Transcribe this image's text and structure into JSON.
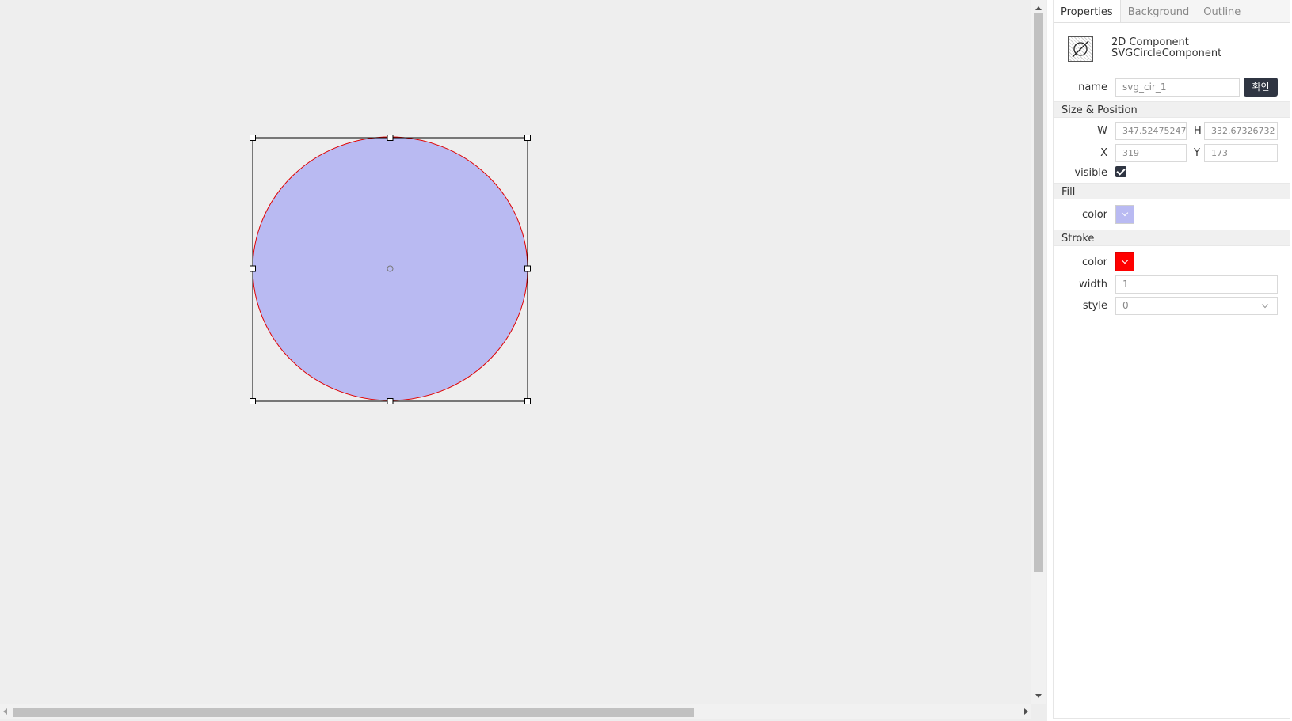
{
  "tabs": [
    "Properties",
    "Background",
    "Outline"
  ],
  "component": {
    "type_line1": "2D Component",
    "type_line2": "SVGCircleComponent",
    "icon": "circle-slash-icon"
  },
  "name_row": {
    "label": "name",
    "value": "svg_cir_1",
    "confirm_label": "확인"
  },
  "size_position": {
    "header": "Size & Position",
    "w_label": "W",
    "w_value": "347.52475247",
    "h_label": "H",
    "h_value": "332.67326732",
    "x_label": "X",
    "x_value": "319",
    "y_label": "Y",
    "y_value": "173",
    "visible_label": "visible",
    "visible_checked": true
  },
  "fill": {
    "header": "Fill",
    "color_label": "color",
    "color": "#b9baf2"
  },
  "stroke": {
    "header": "Stroke",
    "color_label": "color",
    "color": "#ff0000",
    "width_label": "width",
    "width_value": "1",
    "style_label": "style",
    "style_value": "0"
  },
  "canvas": {
    "shape_fill": "#b9baf2",
    "shape_stroke": "#e00000"
  }
}
